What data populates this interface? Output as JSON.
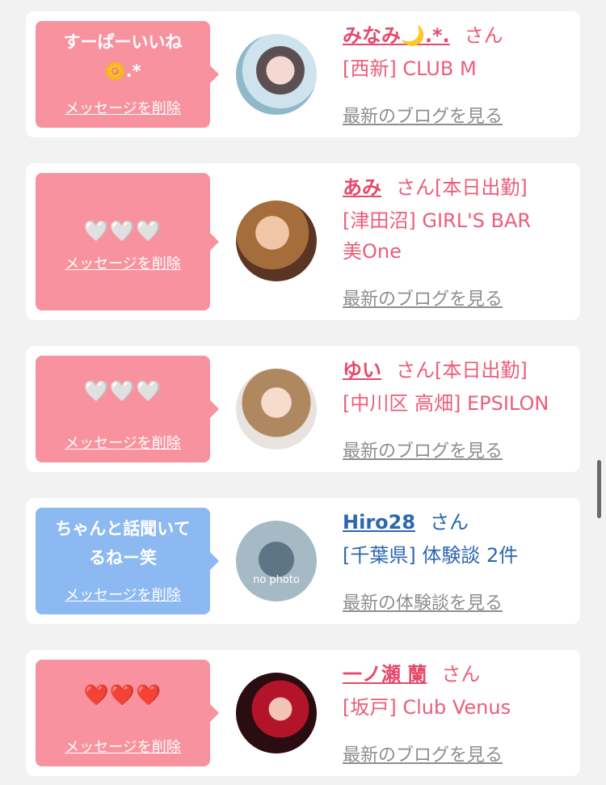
{
  "cards": [
    {
      "message": "すーぱーいいね\n🌼.*",
      "delete_label": "メッセージを削除",
      "name": "みなみ🌙.*.",
      "honorific": "さん",
      "shop": "[西新] CLUB M",
      "blog_link": "最新のブログを見る"
    },
    {
      "message": "🤍🤍🤍",
      "delete_label": "メッセージを削除",
      "name": "あみ",
      "honorific": "さん[本日出勤]",
      "shop": "[津田沼] GIRL'S BAR\n美One",
      "blog_link": "最新のブログを見る"
    },
    {
      "message": "🤍🤍🤍",
      "delete_label": "メッセージを削除",
      "name": "ゆい",
      "honorific": "さん[本日出勤]",
      "shop": "[中川区 高畑] EPSILON",
      "blog_link": "最新のブログを見る"
    },
    {
      "message": "ちゃんと話聞いて\nるねー笑",
      "delete_label": "メッセージを削除",
      "name": "Hiro28",
      "honorific": "さん",
      "shop": "[千葉県] 体験談 2件",
      "blog_link": "最新の体験談を見る",
      "avatar_text": "no photo"
    },
    {
      "message": "❤️❤️❤️",
      "delete_label": "メッセージを削除",
      "name": "一ノ瀬 蘭",
      "honorific": "さん",
      "shop": "[坂戸] Club Venus",
      "blog_link": "最新のブログを見る"
    }
  ],
  "colors": {
    "pink_bubble": "#f7929e",
    "blue_bubble": "#8db9f2",
    "name_pink": "#e44a6b",
    "name_blue": "#2d67ae",
    "link_gray": "#8e8e8e",
    "background": "#f2f2f2"
  }
}
